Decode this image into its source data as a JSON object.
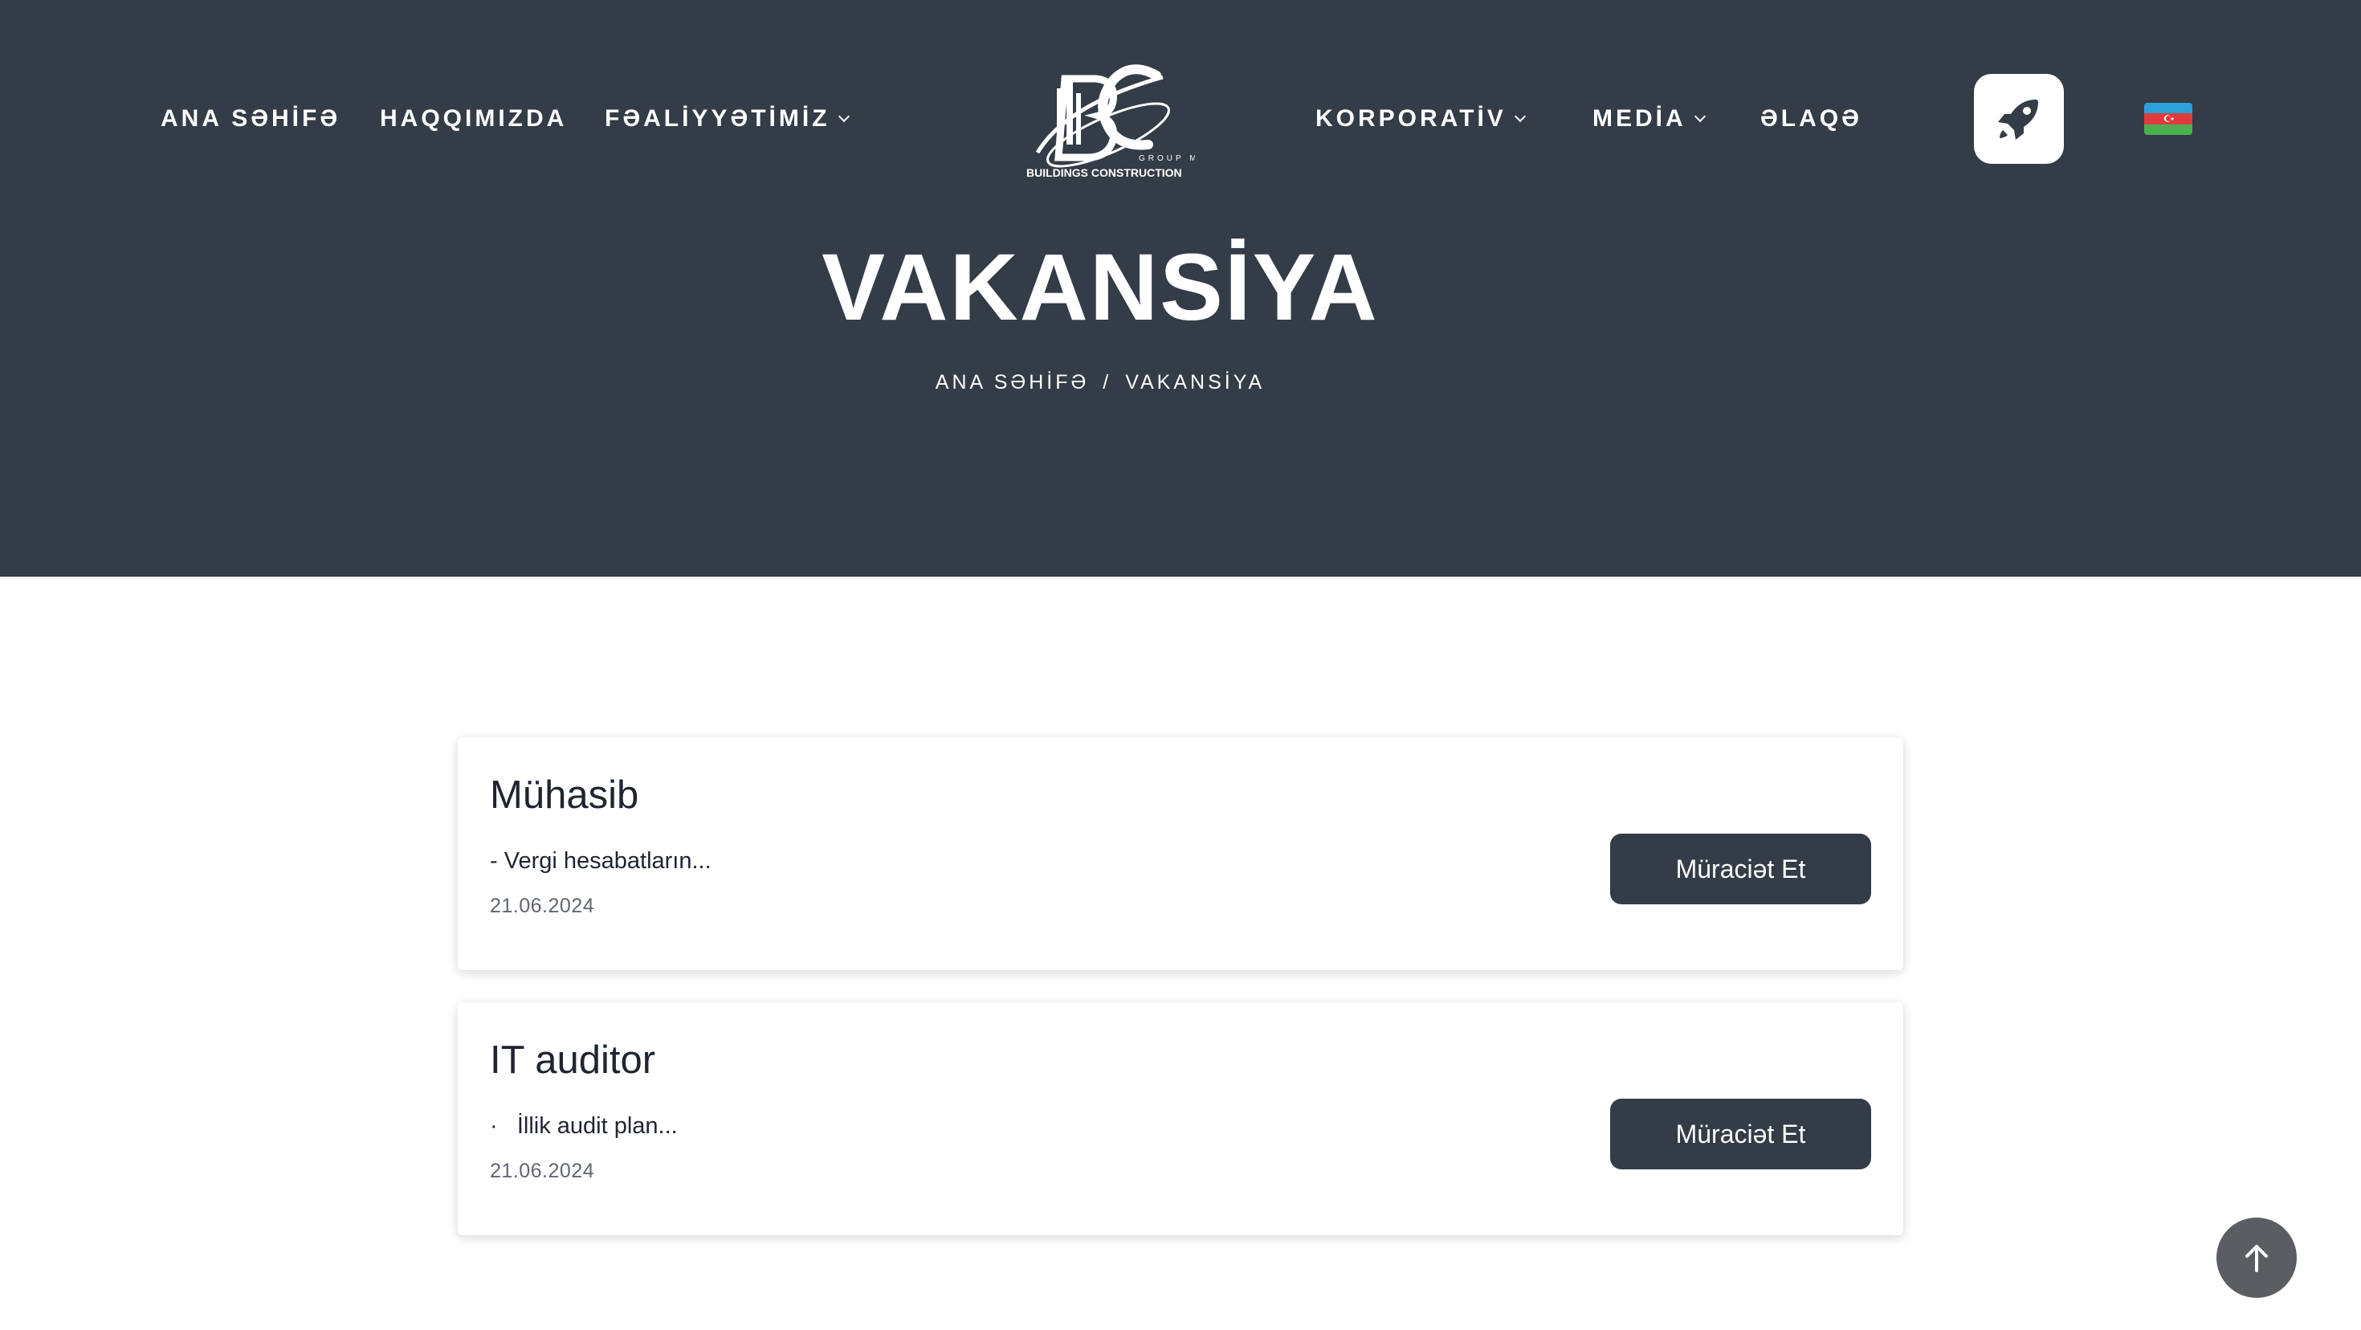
{
  "nav": {
    "left": [
      {
        "label": "ANA SƏHİFƏ",
        "dropdown": false
      },
      {
        "label": "HAQQIMIZDA",
        "dropdown": false
      },
      {
        "label": "FƏALİYYƏTİMİZ",
        "dropdown": true
      }
    ],
    "right": [
      {
        "label": "KORPORATİV",
        "dropdown": true
      },
      {
        "label": "MEDİA",
        "dropdown": true
      },
      {
        "label": "ƏLAQƏ",
        "dropdown": false
      }
    ],
    "logo": {
      "brand_text": "BUILDINGS CONSTRUCTION",
      "sub_text": "GROUP MMC",
      "icon": "bc-logo"
    },
    "rocket_icon": "rocket-icon",
    "language_flag": "azerbaijan-flag-icon"
  },
  "header": {
    "title": "VAKANSİYA",
    "breadcrumb": {
      "home": "ANA SƏHİFƏ",
      "separator": "/",
      "current": "VAKANSİYA"
    }
  },
  "vacancies": [
    {
      "title": "Mühasib",
      "description": "- Vergi hesabatların...",
      "date": "21.06.2024",
      "button": "Müraciət Et"
    },
    {
      "title": "IT auditor",
      "description": "·   İllik audit plan...",
      "date": "21.06.2024",
      "button": "Müraciət Et"
    }
  ],
  "colors": {
    "header_bg": "#343c47",
    "button_bg": "#343c47",
    "scroll_top_bg": "#5a5e63"
  },
  "scroll_top_icon": "arrow-up-icon"
}
